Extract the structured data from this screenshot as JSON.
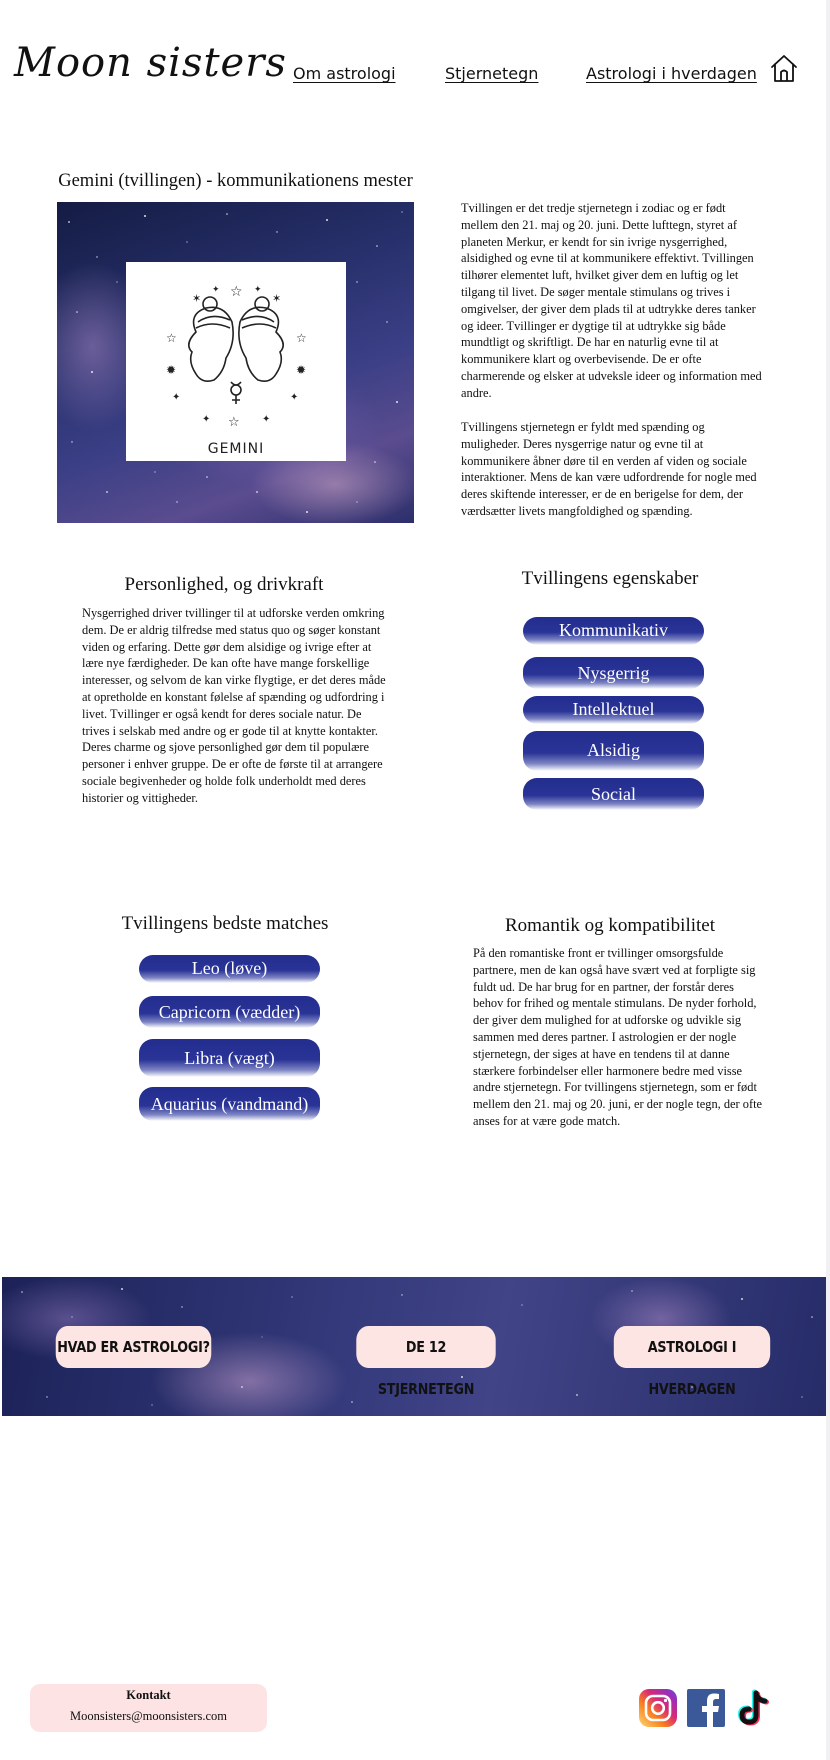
{
  "header": {
    "logo": "Moon sisters",
    "nav": [
      "Om astrologi",
      "Stjernetegn",
      "Astrologi i hverdagen"
    ],
    "home_icon": "home-icon"
  },
  "intro": {
    "title": "Gemini (tvillingen) - kommunikationens mester",
    "image_caption": "GEMINI",
    "text_1": "Tvillingen er det tredje stjernetegn i zodiac og er født mellem den 21. maj og 20. juni. Dette lufttegn, styret af planeten Merkur, er kendt for sin ivrige nysgerrighed, alsidighed og evne til at kommunikere effektivt. Tvillingen tilhører elementet luft, hvilket giver dem en luftig og let tilgang til livet. De søger mentale stimulans og trives i omgivelser, der giver dem plads til at udtrykke deres tanker og ideer. Tvillinger er dygtige til at udtrykke sig både mundtligt og skriftligt. De har en naturlig evne til at kommunikere klart og overbevisende. De er ofte charmerende og elsker at udveksle ideer og information med andre.",
    "text_2": "Tvillingens stjernetegn er fyldt med spænding og muligheder. Deres nysgerrige natur og evne til at kommunikere åbner døre til en verden af viden og sociale interaktioner. Mens de kan være udfordrende for nogle med deres skiftende interesser, er de en berigelse for dem, der værdsætter livets mangfoldighed og spænding."
  },
  "personality": {
    "title": "Personlighed, og  drivkraft",
    "text": "Nysgerrighed driver tvillinger til at udforske verden omkring dem. De er aldrig tilfredse med status quo og søger konstant viden og erfaring. Dette gør dem alsidige og ivrige efter at lære nye færdigheder. De kan ofte have mange forskellige interesser, og selvom de kan virke flygtige, er det deres måde at opretholde en konstant følelse af spænding og udfordring i livet. Tvillinger er også kendt for deres sociale natur. De trives i selskab med andre og er gode til at knytte kontakter. Deres charme og sjove personlighed gør dem til populære personer i enhver gruppe. De er ofte de første til at arrangere sociale begivenheder og holde folk underholdt med deres historier og vittigheder."
  },
  "traits": {
    "title": "Tvillingens egenskaber",
    "items": [
      "Kommunikativ",
      "Nysgerrig",
      "Intellektuel",
      "Alsidig",
      "Social"
    ]
  },
  "matches": {
    "title": "Tvillingens bedste matches",
    "items": [
      "Leo (løve)",
      "Capricorn (vædder)",
      "Libra (vægt)",
      "Aquarius (vandmand)"
    ]
  },
  "romance": {
    "title": "Romantik og kompatibilitet",
    "text": "På den romantiske front er tvillinger omsorgsfulde partnere, men de kan også have svært ved at forpligte sig fuldt ud. De har brug for en partner, der forstår deres behov for frihed og mentale stimulans. De nyder forhold, der giver dem mulighed for at udforske og udvikle sig sammen med deres partner. I astrologien er der nogle stjernetegn, der siges at have en tendens til at danne stærkere forbindelser eller harmonere bedre med visse andre stjernetegn. For tvillingens stjernetegn, som er født mellem den 21. maj og 20. juni, er der nogle tegn, der ofte anses for at være gode match."
  },
  "banner": {
    "buttons": [
      "HVAD ER ASTROLOGI?",
      "DE 12 STJERNETEGN",
      "ASTROLOGI I HVERDAGEN"
    ]
  },
  "footer": {
    "contact_title": "Kontakt",
    "contact_email": "Moonsisters@moonsisters.com",
    "social_icons": [
      "instagram-icon",
      "facebook-icon",
      "tiktok-icon"
    ]
  },
  "colors": {
    "pill_blue": "#232d8e",
    "banner_button": "#fce5e2",
    "contact_bg": "#fde3e3"
  }
}
